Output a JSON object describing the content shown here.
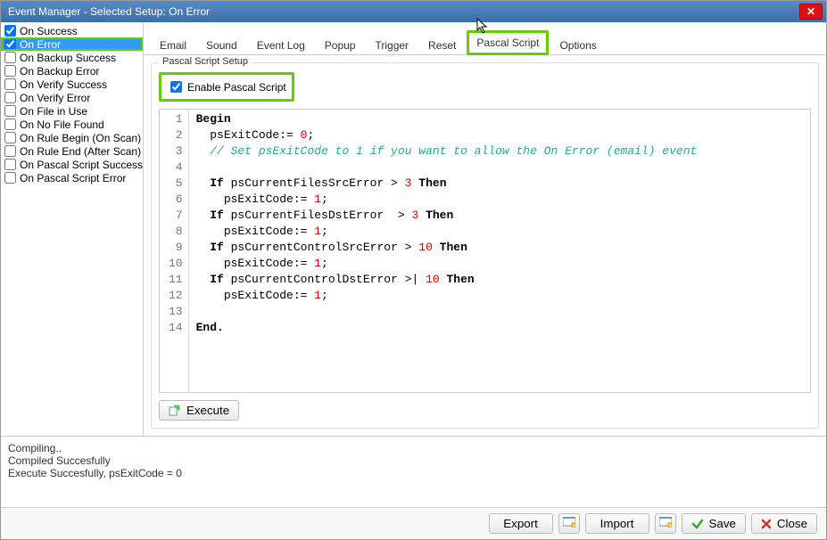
{
  "window": {
    "title": "Event Manager - Selected Setup: On Error"
  },
  "sidebar": {
    "events": [
      {
        "label": "On Success",
        "checked": true,
        "selected": false,
        "hl": false
      },
      {
        "label": "On Error",
        "checked": true,
        "selected": true,
        "hl": true
      },
      {
        "label": "On Backup Success",
        "checked": false,
        "selected": false,
        "hl": false
      },
      {
        "label": "On Backup Error",
        "checked": false,
        "selected": false,
        "hl": false
      },
      {
        "label": "On Verify Success",
        "checked": false,
        "selected": false,
        "hl": false
      },
      {
        "label": "On Verify Error",
        "checked": false,
        "selected": false,
        "hl": false
      },
      {
        "label": "On File in Use",
        "checked": false,
        "selected": false,
        "hl": false
      },
      {
        "label": "On No File Found",
        "checked": false,
        "selected": false,
        "hl": false
      },
      {
        "label": "On Rule Begin (On Scan)",
        "checked": false,
        "selected": false,
        "hl": false
      },
      {
        "label": "On Rule End (After Scan)",
        "checked": false,
        "selected": false,
        "hl": false
      },
      {
        "label": "On Pascal Script Success",
        "checked": false,
        "selected": false,
        "hl": false
      },
      {
        "label": "On Pascal Script Error",
        "checked": false,
        "selected": false,
        "hl": false
      }
    ]
  },
  "tabs": {
    "items": [
      {
        "label": "Email",
        "active": false
      },
      {
        "label": "Sound",
        "active": false
      },
      {
        "label": "Event Log",
        "active": false
      },
      {
        "label": "Popup",
        "active": false
      },
      {
        "label": "Trigger",
        "active": false
      },
      {
        "label": "Reset",
        "active": false
      },
      {
        "label": "Pascal Script",
        "active": true
      },
      {
        "label": "Options",
        "active": false
      }
    ]
  },
  "pascal": {
    "group_label": "Pascal Script Setup",
    "enable_label": "Enable Pascal Script",
    "enable_checked": true,
    "execute_label": "Execute",
    "code_lines": [
      {
        "n": 1,
        "type": "kw",
        "text": "Begin"
      },
      {
        "n": 2,
        "type": "stmt",
        "indent": "  ",
        "text": "psExitCode:= ",
        "num": "0",
        "tail": ";"
      },
      {
        "n": 3,
        "type": "cmt",
        "indent": "  ",
        "text": "// Set psExitCode to 1 if you want to allow the On Error (email) event"
      },
      {
        "n": 4,
        "type": "blank"
      },
      {
        "n": 5,
        "type": "if",
        "indent": "  ",
        "pre": "If ",
        "var": "psCurrentFilesSrcError",
        "op": " > ",
        "num": "3",
        "post": " Then"
      },
      {
        "n": 6,
        "type": "stmt",
        "indent": "    ",
        "text": "psExitCode:= ",
        "num": "1",
        "tail": ";"
      },
      {
        "n": 7,
        "type": "if",
        "indent": "  ",
        "pre": "If ",
        "var": "psCurrentFilesDstError ",
        "op": " > ",
        "num": "3",
        "post": " Then"
      },
      {
        "n": 8,
        "type": "stmt",
        "indent": "    ",
        "text": "psExitCode:= ",
        "num": "1",
        "tail": ";"
      },
      {
        "n": 9,
        "type": "if",
        "indent": "  ",
        "pre": "If ",
        "var": "psCurrentControlSrcError",
        "op": " > ",
        "num": "10",
        "post": " Then"
      },
      {
        "n": 10,
        "type": "stmt",
        "indent": "    ",
        "text": "psExitCode:= ",
        "num": "1",
        "tail": ";"
      },
      {
        "n": 11,
        "type": "if",
        "indent": "  ",
        "pre": "If ",
        "var": "psCurrentControlDstError",
        "op": " >| ",
        "num": "10",
        "post": " Then"
      },
      {
        "n": 12,
        "type": "stmt",
        "indent": "    ",
        "text": "psExitCode:= ",
        "num": "1",
        "tail": ";"
      },
      {
        "n": 13,
        "type": "blank"
      },
      {
        "n": 14,
        "type": "kw",
        "text": "End."
      }
    ]
  },
  "output": {
    "text": "Compiling..\nCompiled Succesfully\nExecute Succesfully, psExitCode = 0"
  },
  "footer": {
    "export": "Export",
    "import": "Import",
    "save": "Save",
    "close": "Close"
  }
}
